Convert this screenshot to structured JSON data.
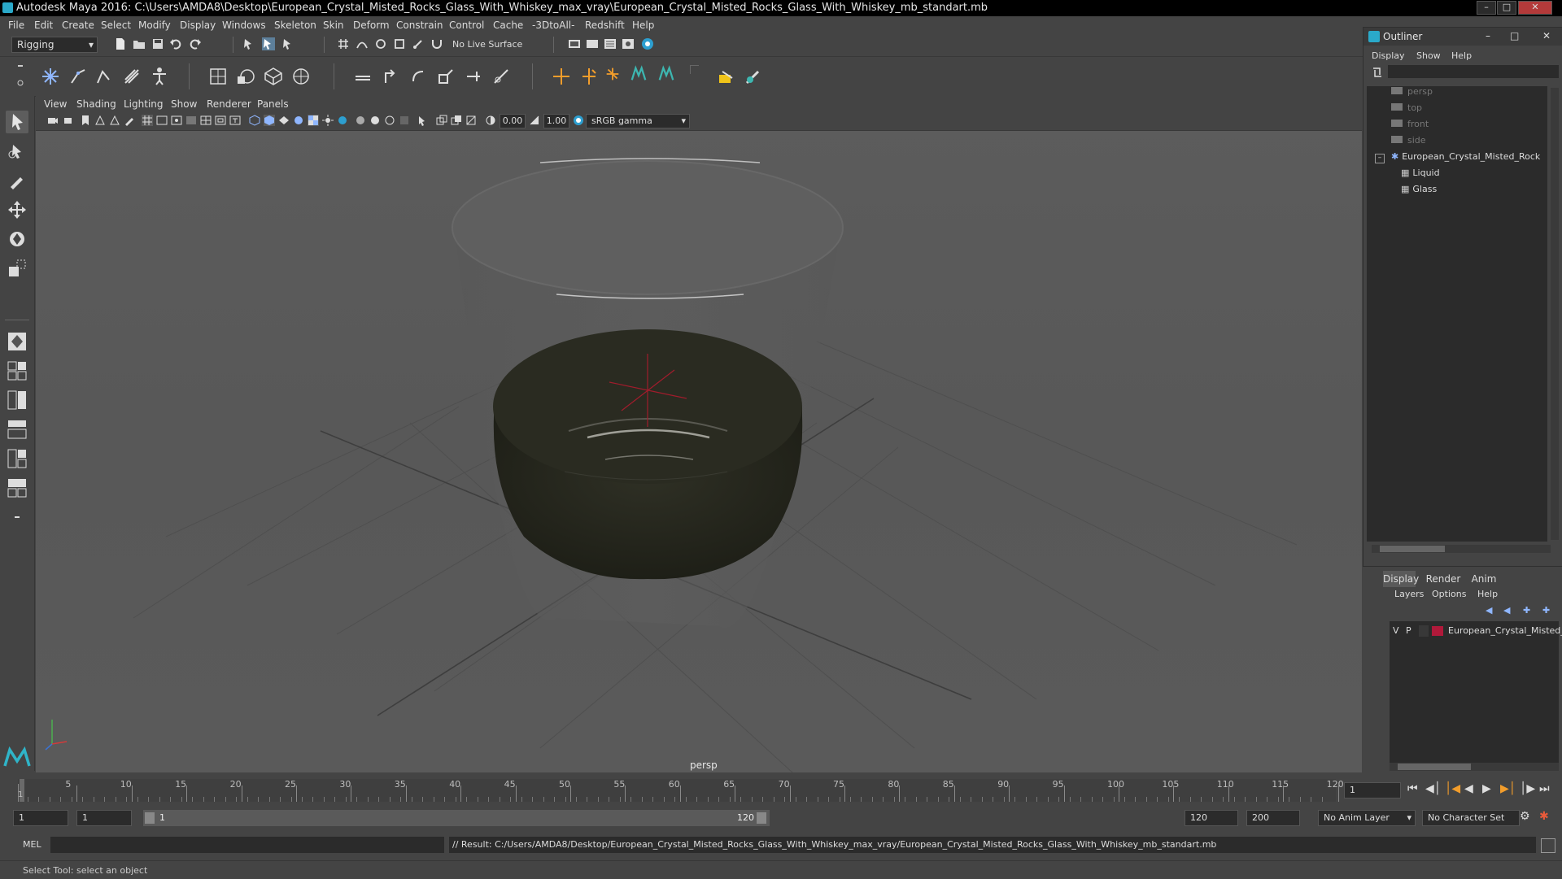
{
  "window": {
    "title": "Autodesk Maya 2016: C:\\Users\\AMDA8\\Desktop\\European_Crystal_Misted_Rocks_Glass_With_Whiskey_max_vray\\European_Crystal_Misted_Rocks_Glass_With_Whiskey_mb_standart.mb"
  },
  "menubar": {
    "items": [
      "File",
      "Edit",
      "Create",
      "Select",
      "Modify",
      "Display",
      "Windows",
      "Skeleton",
      "Skin",
      "Deform",
      "Constrain",
      "Control",
      "Cache",
      "-3DtoAll-",
      "Redshift",
      "Help"
    ]
  },
  "statusline": {
    "mode": "Rigging",
    "live_surface": "No Live Surface"
  },
  "viewport": {
    "menu": [
      "View",
      "Shading",
      "Lighting",
      "Show",
      "Renderer",
      "Panels"
    ],
    "exposure": "0.00",
    "gamma": "1.00",
    "color_space": "sRGB gamma",
    "camera_label": "persp"
  },
  "outliner": {
    "title": "Outliner",
    "menu": [
      "Display",
      "Show",
      "Help"
    ],
    "items": [
      {
        "label": "persp",
        "type": "camera"
      },
      {
        "label": "top",
        "type": "camera"
      },
      {
        "label": "front",
        "type": "camera"
      },
      {
        "label": "side",
        "type": "camera"
      },
      {
        "label": "European_Crystal_Misted_Rock",
        "type": "group"
      },
      {
        "label": "Liquid",
        "type": "mesh"
      },
      {
        "label": "Glass",
        "type": "mesh"
      }
    ]
  },
  "layer_editor": {
    "tabs": [
      "Display",
      "Render",
      "Anim"
    ],
    "menu": [
      "Layers",
      "Options",
      "Help"
    ],
    "layer": {
      "v": "V",
      "p": "P",
      "name": "European_Crystal_Misted_",
      "color": "#b0193a"
    }
  },
  "timeslider": {
    "ticks": [
      "5",
      "10",
      "15",
      "20",
      "25",
      "30",
      "35",
      "40",
      "45",
      "50",
      "55",
      "60",
      "65",
      "70",
      "75",
      "80",
      "85",
      "90",
      "95",
      "100",
      "105",
      "110",
      "115",
      "120"
    ],
    "current_frame_marker": "1",
    "current_frame": "1"
  },
  "rangeslider": {
    "start": "1",
    "playback_start": "1",
    "range_start_label": "1",
    "range_end_label": "120",
    "playback_end": "120",
    "end": "200",
    "anim_layer": "No Anim Layer",
    "character_set": "No Character Set"
  },
  "cmdline": {
    "label": "MEL",
    "result": "// Result: C:/Users/AMDA8/Desktop/European_Crystal_Misted_Rocks_Glass_With_Whiskey_max_vray/European_Crystal_Misted_Rocks_Glass_With_Whiskey_mb_standart.mb"
  },
  "helpline": {
    "text": "Select Tool: select an object"
  }
}
